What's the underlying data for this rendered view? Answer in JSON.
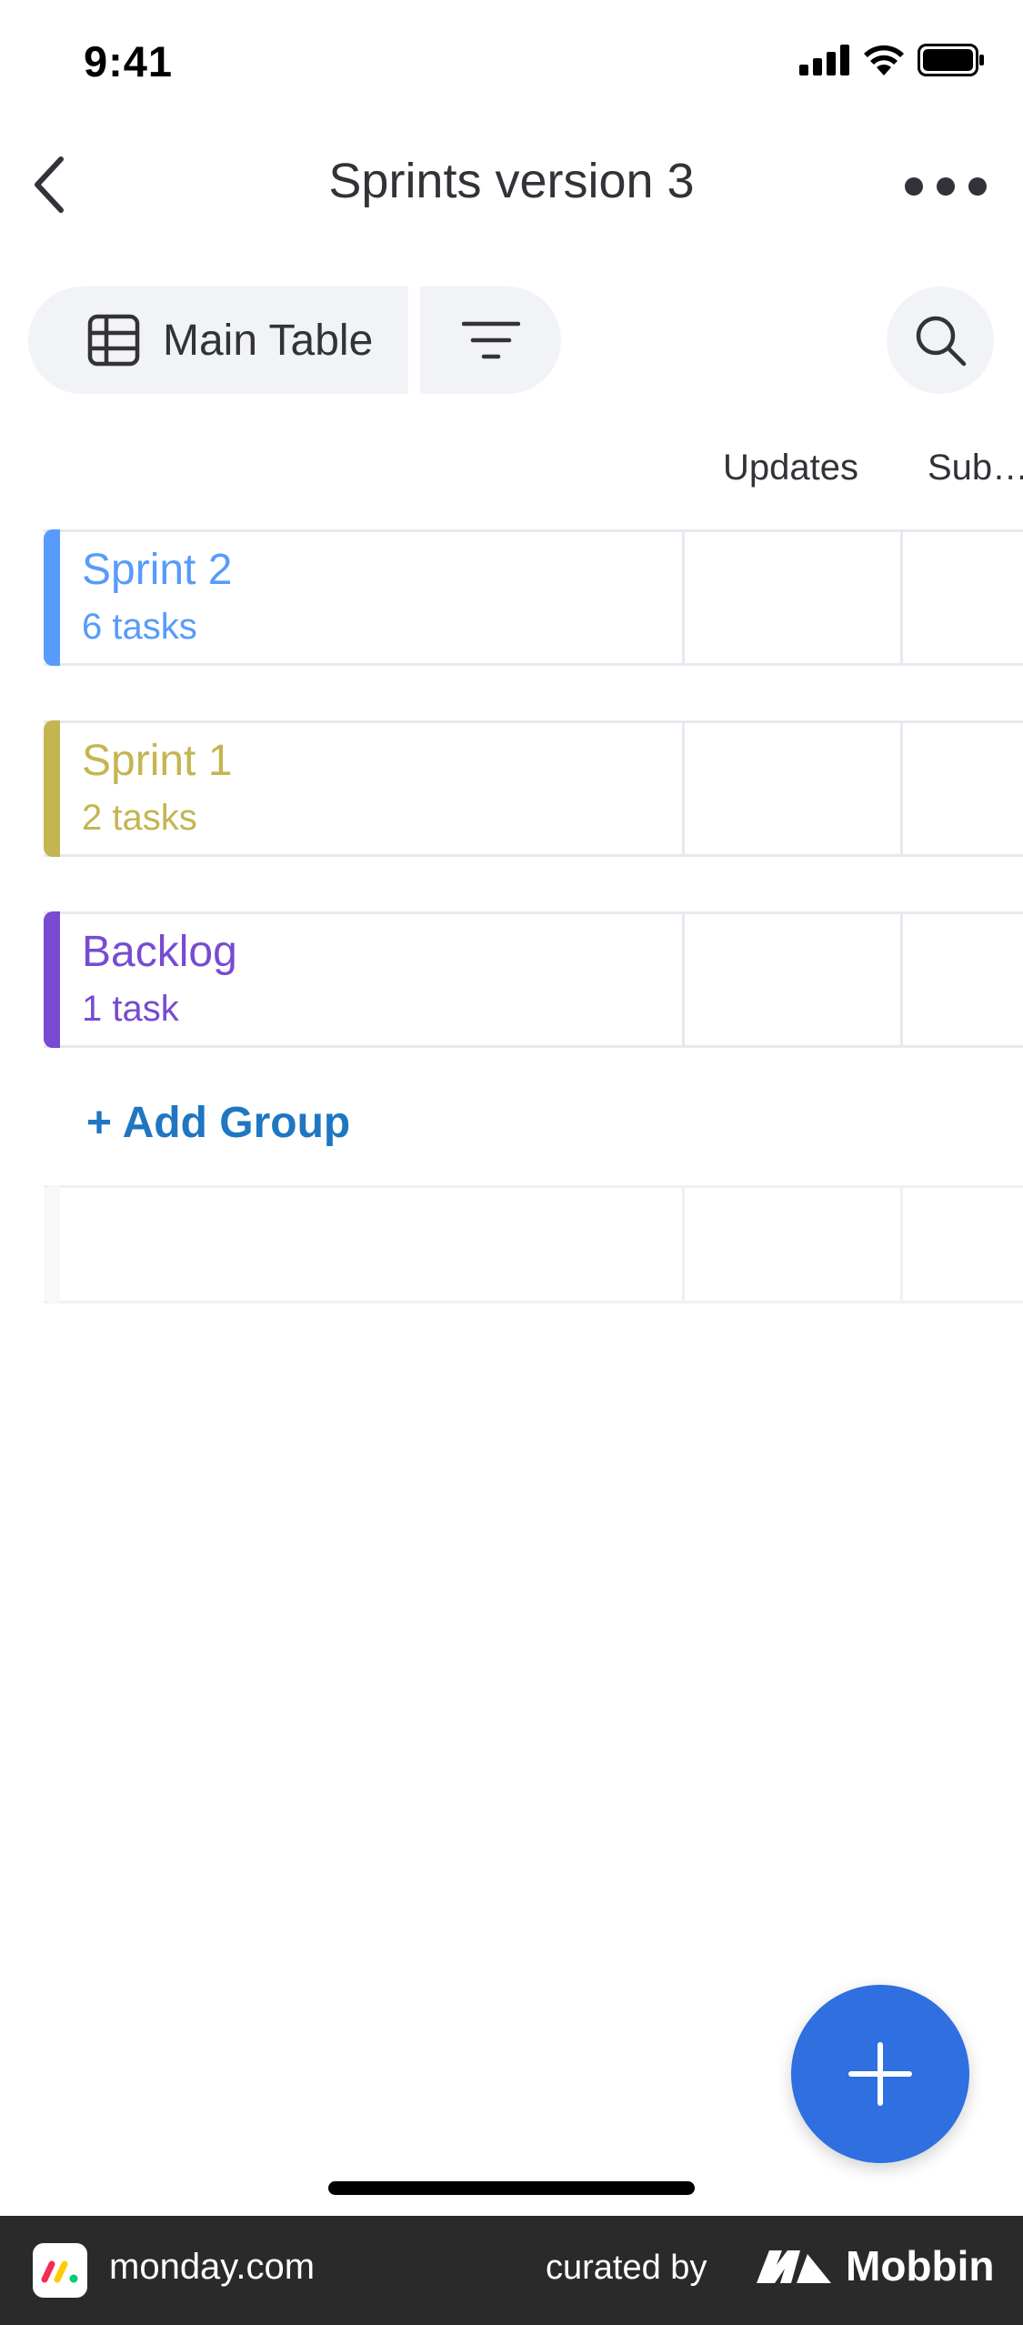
{
  "status_bar": {
    "time": "9:41"
  },
  "header": {
    "title": "Sprints version 3"
  },
  "toolbar": {
    "view_label": "Main Table"
  },
  "columns": {
    "updates": "Updates",
    "subitems": "Sub…"
  },
  "groups": [
    {
      "name": "Sprint 2",
      "count": "6 tasks",
      "color": "#579bfc"
    },
    {
      "name": "Sprint 1",
      "count": "2 tasks",
      "color": "#c4b551"
    },
    {
      "name": "Backlog",
      "count": "1 task",
      "color": "#784bd1"
    }
  ],
  "add_group_label": "+ Add Group",
  "footer": {
    "app_name": "monday.com",
    "curated_by": "curated by",
    "brand": "Mobbin"
  },
  "colors": {
    "accent": "#2f6fe0",
    "link": "#1f76c2"
  }
}
